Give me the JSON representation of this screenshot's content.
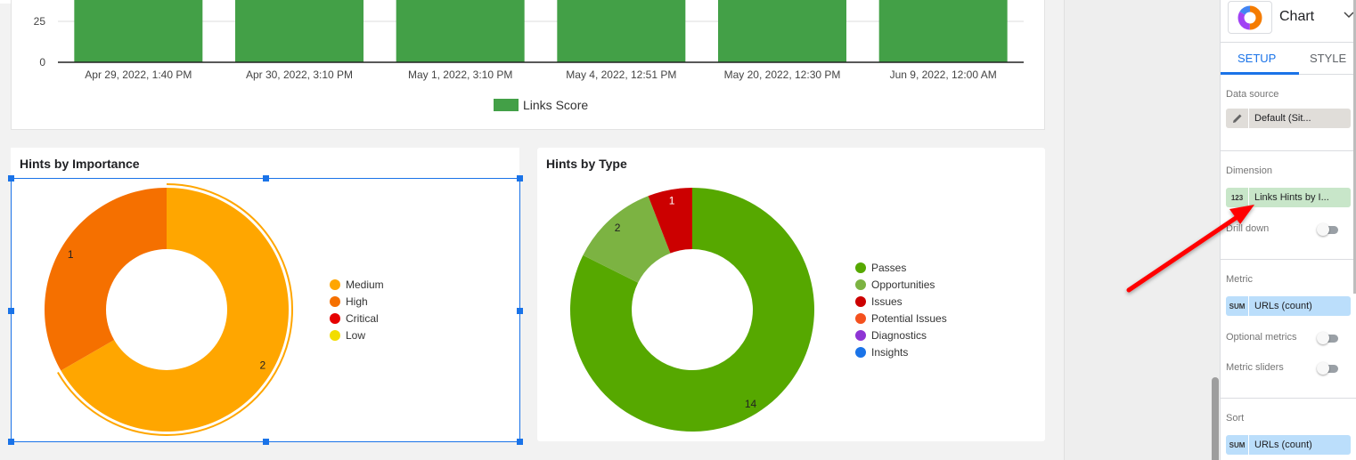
{
  "bar_chart": {
    "chart_data": {
      "type": "bar",
      "categories": [
        "Apr 29, 2022, 1:40 PM",
        "Apr 30, 2022, 3:10 PM",
        "May 1, 2022, 3:10 PM",
        "May 4, 2022, 12:51 PM",
        "May 20, 2022, 12:30 PM",
        "Jun 9, 2022, 12:00 AM"
      ],
      "series": [
        {
          "name": "Links Score",
          "values": [
            100,
            100,
            100,
            100,
            100,
            100
          ],
          "color": "#43a047"
        }
      ],
      "y_ticks_visible": [
        "0",
        "25"
      ],
      "visible_ylim": [
        0,
        33
      ],
      "grid": true,
      "legend_position": "bottom"
    }
  },
  "importance_chart": {
    "title": "Hints by Importance",
    "chart_data": {
      "type": "pie",
      "donut": true,
      "slices": [
        {
          "label": "Medium",
          "value": 2,
          "color": "#ffa600"
        },
        {
          "label": "High",
          "value": 1,
          "color": "#f57000"
        },
        {
          "label": "Critical",
          "value": 0,
          "color": "#e60000"
        },
        {
          "label": "Low",
          "value": 0,
          "color": "#f2dd00"
        }
      ],
      "highlighted_slice": "Medium",
      "legend_position": "right"
    }
  },
  "type_chart": {
    "title": "Hints by Type",
    "chart_data": {
      "type": "pie",
      "donut": true,
      "slices": [
        {
          "label": "Passes",
          "value": 14,
          "color": "#56a800"
        },
        {
          "label": "Opportunities",
          "value": 2,
          "color": "#7cb342"
        },
        {
          "label": "Issues",
          "value": 1,
          "color": "#cc0000"
        },
        {
          "label": "Potential Issues",
          "value": 0,
          "color": "#f4511e"
        },
        {
          "label": "Diagnostics",
          "value": 0,
          "color": "#8e35d4"
        },
        {
          "label": "Insights",
          "value": 0,
          "color": "#1a73e8"
        }
      ],
      "legend_position": "right"
    }
  },
  "panel": {
    "chart_type_label": "Chart",
    "tabs": [
      {
        "label": "SETUP",
        "active": true
      },
      {
        "label": "STYLE",
        "active": false
      }
    ],
    "data_source": {
      "label": "Data source",
      "value": "Default (Sit..."
    },
    "dimension": {
      "label": "Dimension",
      "type_badge": "123",
      "value": "Links Hints by I..."
    },
    "drill_down": {
      "label": "Drill down",
      "on": false
    },
    "metric": {
      "label": "Metric",
      "agg_badge": "SUM",
      "value": "URLs (count)"
    },
    "optional_metrics": {
      "label": "Optional metrics",
      "on": false
    },
    "metric_sliders": {
      "label": "Metric sliders",
      "on": false
    },
    "sort": {
      "label": "Sort",
      "agg_badge": "SUM",
      "value": "URLs (count)"
    }
  },
  "annotation": {
    "arrow_color": "#ff0000"
  }
}
